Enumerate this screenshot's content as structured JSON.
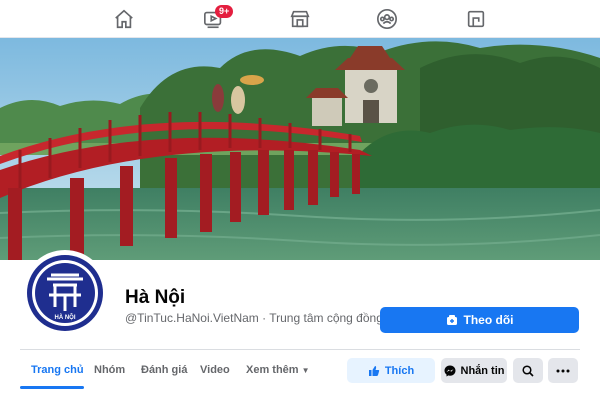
{
  "topnav": {
    "items": [
      "home-icon",
      "watch-icon",
      "marketplace-icon",
      "groups-icon",
      "gaming-icon"
    ],
    "watch_badge": "9+"
  },
  "page": {
    "name": "Hà Nội",
    "handle": "@TinTuc.HaNoi.VietNam",
    "separator": "·",
    "category": "Trung tâm cộng đồng",
    "follow_label": "Theo dõi",
    "avatar_text": "HÀ NỘI"
  },
  "tabs": [
    {
      "label": "Trang chủ",
      "active": true
    },
    {
      "label": "Nhóm"
    },
    {
      "label": "Đánh giá"
    },
    {
      "label": "Video"
    },
    {
      "label": "Xem thêm",
      "dropdown": true
    }
  ],
  "actions": {
    "like_label": "Thích",
    "message_label": "Nhắn tin"
  },
  "colors": {
    "primary": "#1877f2",
    "badge": "#e41e3f",
    "bridge": "#b21e24"
  }
}
